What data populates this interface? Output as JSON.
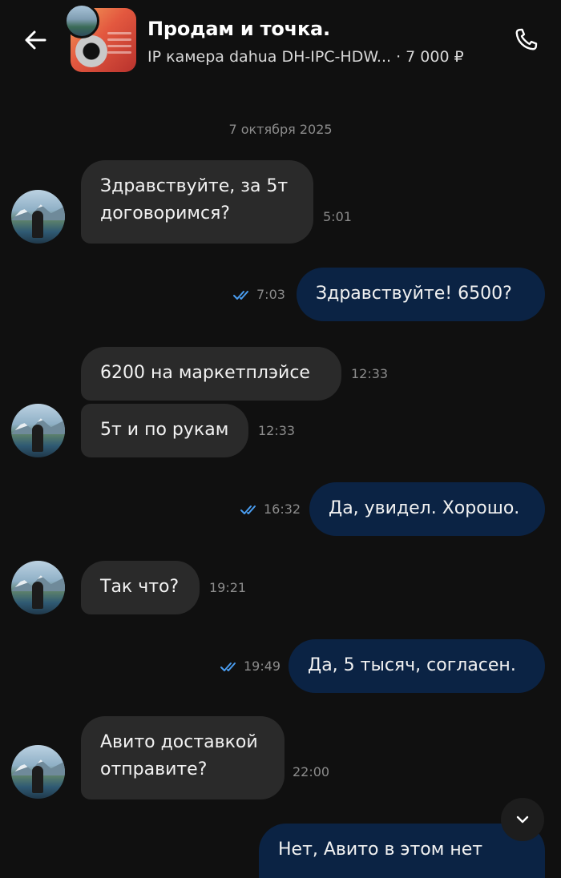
{
  "header": {
    "title": "Продам и точка.",
    "subtitle": "IP камера dahua DH-IPC-HDW... · 7 000 ₽",
    "back_icon": "arrow-left-icon",
    "call_icon": "phone-icon"
  },
  "chat": {
    "date": "7 октября 2025",
    "messages": [
      {
        "dir": "in",
        "line1": "Здравствуйте, за 5т",
        "line2": "договоримся?",
        "time": "5:01"
      },
      {
        "dir": "out",
        "text": "Здравствуйте! 6500?",
        "time": "7:03",
        "read": true
      },
      {
        "dir": "in",
        "text": "6200 на маркетплэйсе",
        "time": "12:33"
      },
      {
        "dir": "in",
        "text": "5т и по рукам",
        "time": "12:33"
      },
      {
        "dir": "out",
        "text": "Да, увидел. Хорошо.",
        "time": "16:32",
        "read": true
      },
      {
        "dir": "in",
        "text": "Так что?",
        "time": "19:21"
      },
      {
        "dir": "out",
        "text": "Да, 5 тысяч, согласен.",
        "time": "19:49",
        "read": true
      },
      {
        "dir": "in",
        "line1": "Авито доставкой",
        "line2": "отправите?",
        "time": "22:00"
      },
      {
        "dir": "out",
        "text": "Нет, Авито в этом нет"
      }
    ]
  },
  "colors": {
    "background": "#101010",
    "incoming_bubble": "#2a2a2a",
    "outgoing_bubble": "#0b2344",
    "read_ticks": "#4a9df0",
    "muted_text": "#8c8c8c"
  },
  "scroll_icon": "chevron-down-icon"
}
